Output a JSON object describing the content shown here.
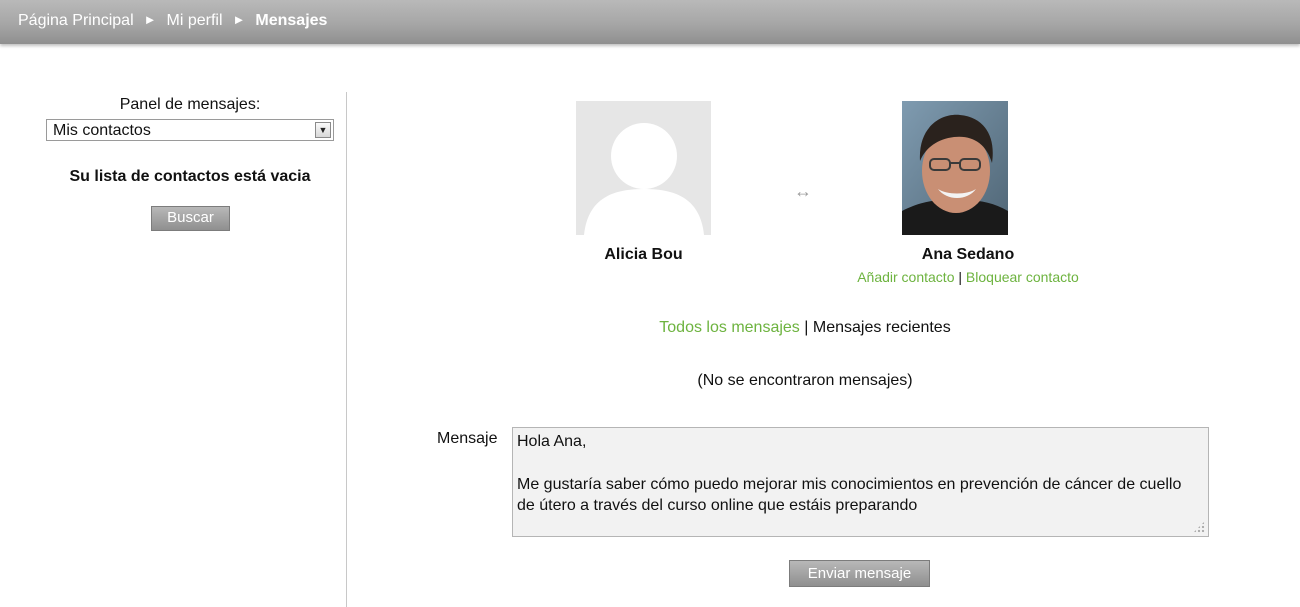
{
  "breadcrumb": {
    "items": [
      "Página Principal",
      "Mi perfil"
    ],
    "separator": "►",
    "current": "Mensajes"
  },
  "sidebar": {
    "panel_label": "Panel de mensajes:",
    "panel_selected": "Mis contactos",
    "empty_text": "Su lista de contactos está vacia",
    "search_button": "Buscar"
  },
  "conversation": {
    "user_left": "Alicia Bou",
    "user_right": "Ana Sedano",
    "swap_glyph": "↔",
    "add_contact": "Añadir contacto",
    "action_separator": "|",
    "block_contact": "Bloquear contacto",
    "filter_all": "Todos los mensajes",
    "filter_separator": "|",
    "filter_recent": "Mensajes recientes",
    "no_messages": "(No se encontraron mensajes)"
  },
  "compose": {
    "label": "Mensaje",
    "line1": "Hola Ana,",
    "line2": "Me gustaría saber cómo puedo mejorar mis conocimientos en prevención de cáncer de cuello de útero a través del curso online que estáis preparando",
    "send_button": "Enviar mensaje"
  },
  "colors": {
    "link": "#6db33f",
    "topbar": "#a6a6a6",
    "button": "#9a9a9a"
  }
}
